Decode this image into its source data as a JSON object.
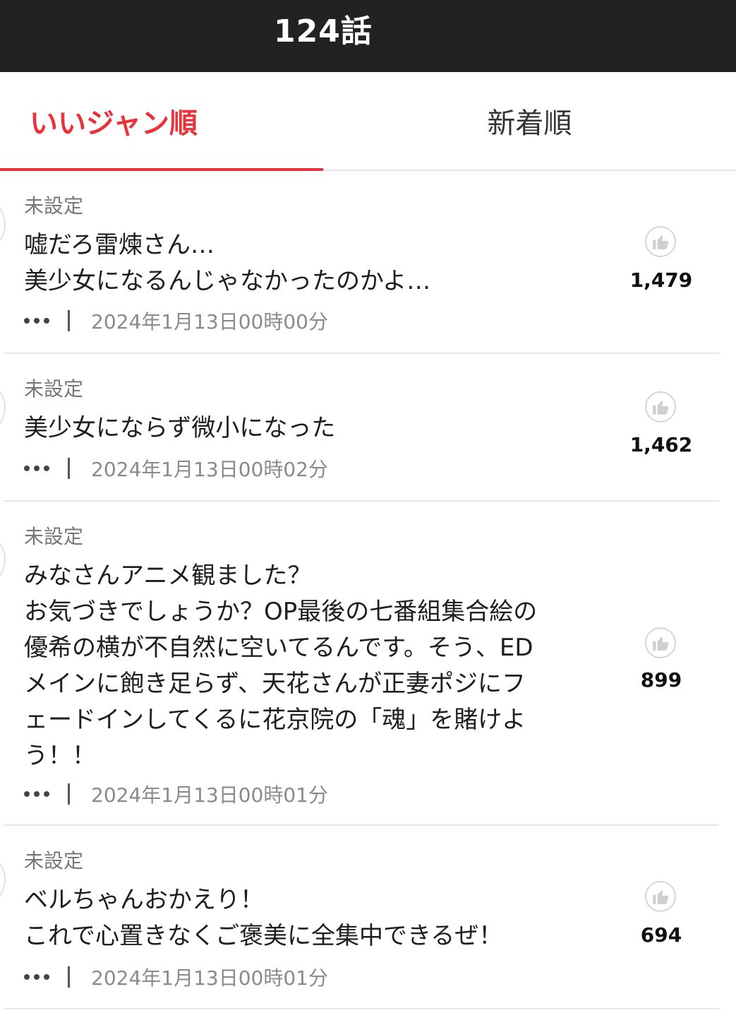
{
  "header": {
    "title": "124話"
  },
  "tabs": [
    {
      "label": "いいジャン順",
      "active": true
    },
    {
      "label": "新着順",
      "active": false
    }
  ],
  "colors": {
    "accent": "#e8333a",
    "header_bg": "#222222"
  },
  "comments": [
    {
      "user": "未設定",
      "text": "嘘だろ雷煉さん…\n美少女になるんじゃなかったのかよ…",
      "likes": "1,479",
      "timestamp": "2024年1月13日00時00分"
    },
    {
      "user": "未設定",
      "text": "美少女にならず微小になった",
      "likes": "1,462",
      "timestamp": "2024年1月13日00時02分"
    },
    {
      "user": "未設定",
      "text": "みなさんアニメ観ました？\nお気づきでしょうか？OP最後の七番組集合絵の\n優希の横が不自然に空いてるんです。そう、ED\nメインに飽き足らず、天花さんが正妻ポジにフ\nェードインしてくるに花京院の「魂」を賭けよ\nう！！",
      "likes": "899",
      "timestamp": "2024年1月13日00時01分"
    },
    {
      "user": "未設定",
      "text": "ベルちゃんおかえり！\nこれで心置きなくご褒美に全集中できるぜ！",
      "likes": "694",
      "timestamp": "2024年1月13日00時01分"
    }
  ]
}
